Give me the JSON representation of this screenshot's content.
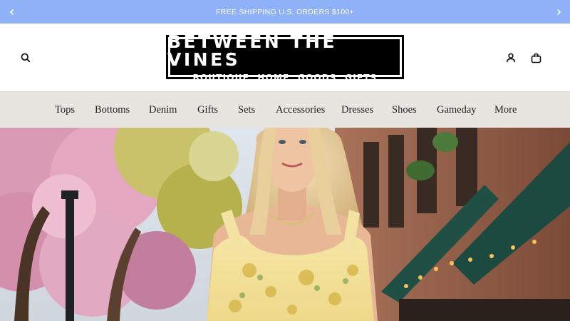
{
  "announcement": {
    "text": "FREE SHIPPING U.S. ORDERS $100+",
    "prev_icon": "chevron-left-icon",
    "next_icon": "chevron-right-icon",
    "background": "#8fb1f7"
  },
  "header": {
    "logo": {
      "line1": "BETWEEN THE VINES",
      "line2": "BOUTIQUE HOME GOODS GIFTS"
    },
    "icons": [
      "search-icon",
      "account-icon",
      "cart-icon"
    ]
  },
  "nav": {
    "items": [
      {
        "label": "Tops"
      },
      {
        "label": "Bottoms"
      },
      {
        "label": "Denim"
      },
      {
        "label": "Gifts"
      },
      {
        "label": "Sets"
      },
      {
        "label": "Accessories"
      },
      {
        "label": "Dresses"
      },
      {
        "label": "Shoes"
      },
      {
        "label": "Gameday"
      },
      {
        "label": "More"
      }
    ],
    "background": "#e8e5e0"
  }
}
